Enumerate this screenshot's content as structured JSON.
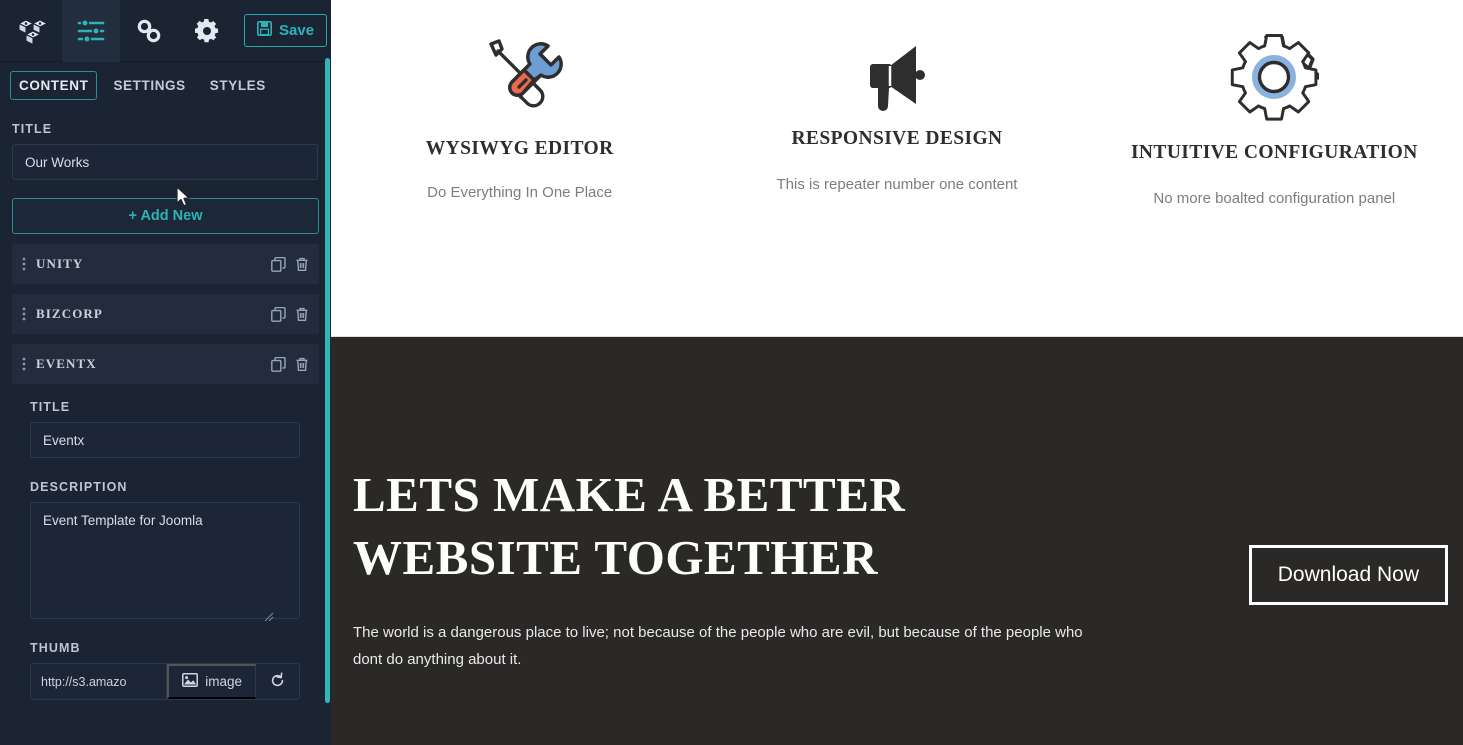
{
  "toolbar": {
    "icons": [
      {
        "name": "blocks-icon",
        "label": "Blocks"
      },
      {
        "name": "sliders-icon",
        "label": "Settings Sliders"
      },
      {
        "name": "link-icon",
        "label": "Link"
      },
      {
        "name": "gear-icon",
        "label": "Gear"
      }
    ],
    "save_label": "Save",
    "accent_color": "#2bb3b8"
  },
  "tabs": [
    {
      "label": "CONTENT",
      "active": true
    },
    {
      "label": "SETTINGS",
      "active": false
    },
    {
      "label": "STYLES",
      "active": false
    }
  ],
  "panel": {
    "title_label": "TITLE",
    "title_value": "Our Works",
    "add_new_label": "+ Add New",
    "items": [
      {
        "label": "UNITY",
        "expanded": false
      },
      {
        "label": "BIZCORP",
        "expanded": false
      },
      {
        "label": "EVENTX",
        "expanded": true
      }
    ],
    "expanded_item": {
      "title_label": "TITLE",
      "title_value": "Eventx",
      "description_label": "DESCRIPTION",
      "description_value": "Event Template for Joomla",
      "thumb_label": "THUMB",
      "thumb_url": "http://s3.amazo",
      "thumb_button_label": "image",
      "thumb_reset_label": "reset"
    }
  },
  "preview": {
    "features": [
      {
        "icon": "screwdriver-wrench-icon",
        "title": "WYSIWYG EDITOR",
        "subtitle": "Do Everything In One Place"
      },
      {
        "icon": "megaphone-icon",
        "title": "RESPONSIVE DESIGN",
        "subtitle": "This is repeater number one content"
      },
      {
        "icon": "gear-outline-icon",
        "title": "INTUITIVE CONFIGURATION",
        "subtitle": "No more boalted configuration panel"
      }
    ],
    "hero": {
      "title": "LETS MAKE A BETTER WEBSITE TOGETHER",
      "paragraph": "The world is a dangerous place to live; not because of the people who are evil, but because of the people who dont do anything about it.",
      "button_label": "Download Now",
      "background_color": "#2b2927"
    }
  }
}
